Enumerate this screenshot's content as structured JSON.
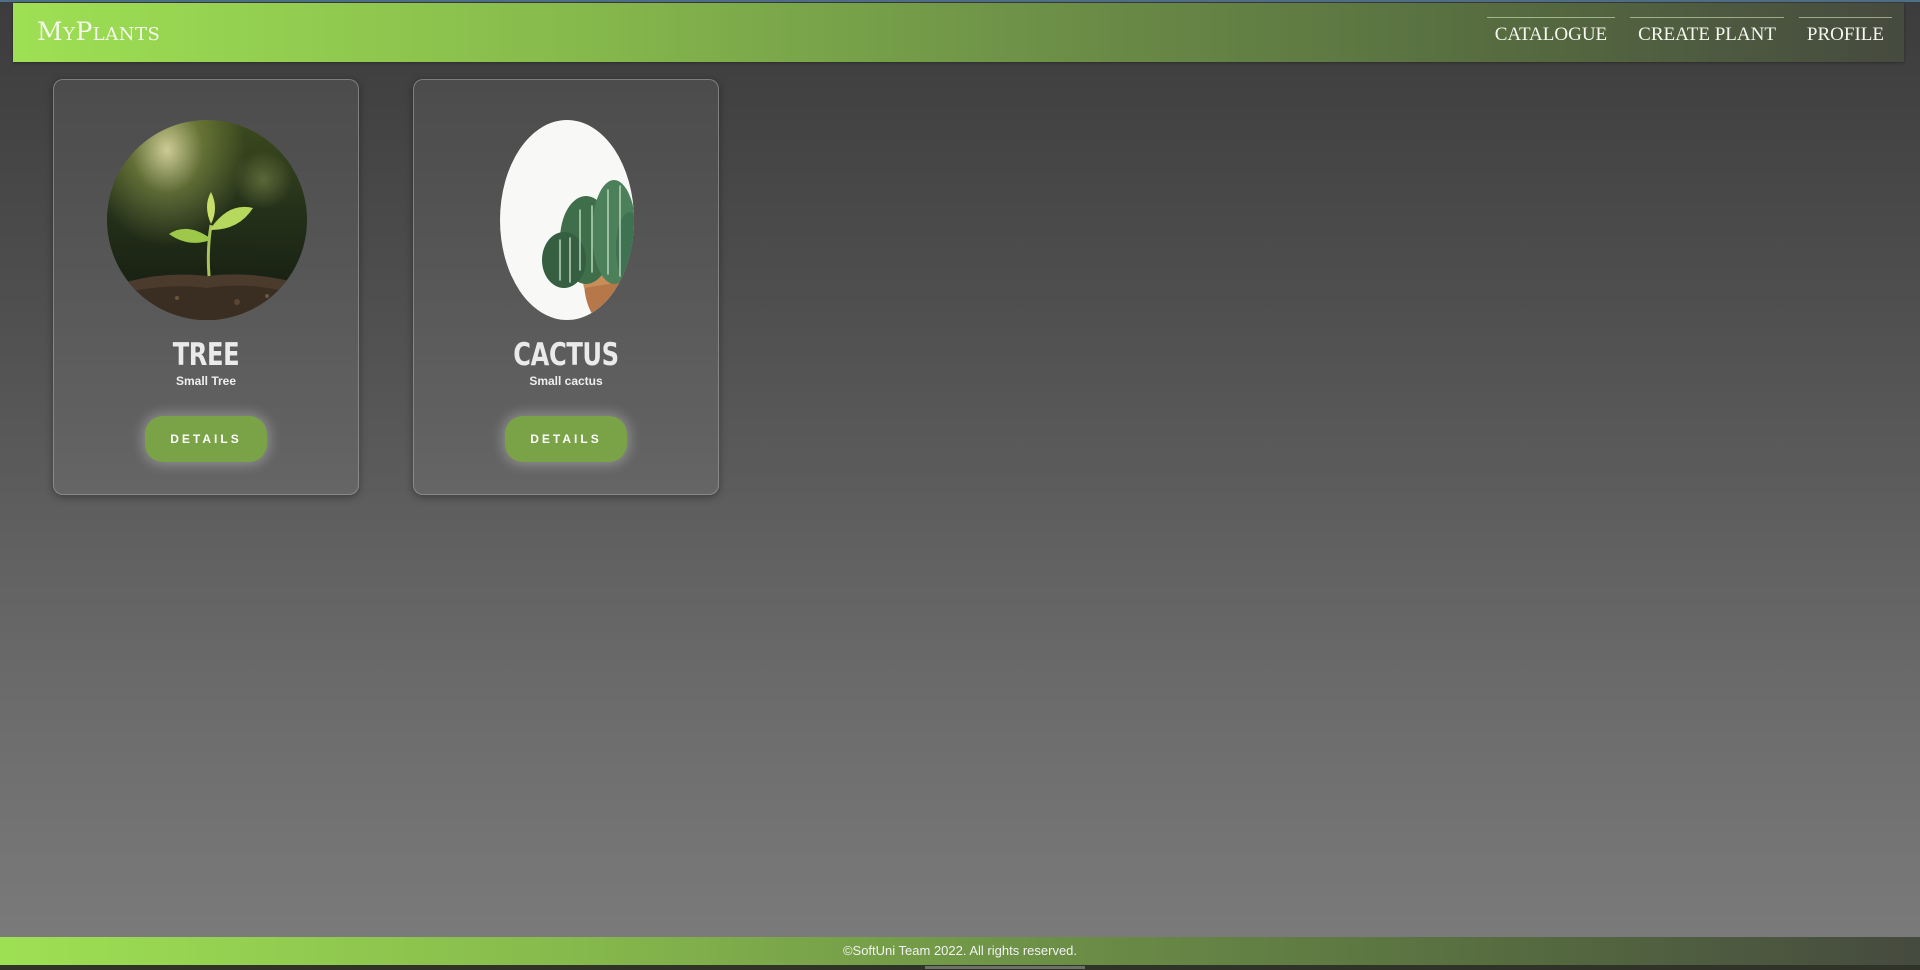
{
  "header": {
    "logo": "MyPlants",
    "nav": [
      "Catalogue",
      "Create Plant",
      "Profile"
    ]
  },
  "cards": [
    {
      "title": "TREE",
      "subtitle": "Small Tree",
      "button": "DETAILS",
      "image": "seedling-photo"
    },
    {
      "title": "CACTUS",
      "subtitle": "Small cactus",
      "button": "DETAILS",
      "image": "cactus-photo"
    }
  ],
  "footer": {
    "text": "©SoftUni Team 2022. All rights reserved."
  },
  "colors": {
    "accent_green": "#7aa347",
    "header_start": "#9ee054",
    "header_end": "#464a3f"
  }
}
